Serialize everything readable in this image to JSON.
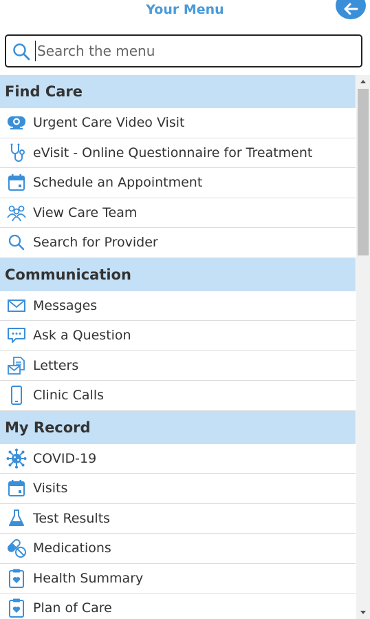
{
  "header": {
    "title": "Your Menu"
  },
  "search": {
    "placeholder": "Search the menu",
    "value": ""
  },
  "sections": [
    {
      "title": "Find Care",
      "items": [
        {
          "label": "Urgent Care Video Visit",
          "icon": "video-camera-icon"
        },
        {
          "label": "eVisit - Online Questionnaire for Treatment",
          "icon": "stethoscope-icon"
        },
        {
          "label": "Schedule an Appointment",
          "icon": "calendar-icon"
        },
        {
          "label": "View Care Team",
          "icon": "care-team-icon"
        },
        {
          "label": "Search for Provider",
          "icon": "search-icon"
        }
      ]
    },
    {
      "title": "Communication",
      "items": [
        {
          "label": "Messages",
          "icon": "envelope-icon"
        },
        {
          "label": "Ask a Question",
          "icon": "chat-bubble-icon"
        },
        {
          "label": "Letters",
          "icon": "letter-icon"
        },
        {
          "label": "Clinic Calls",
          "icon": "mobile-phone-icon"
        }
      ]
    },
    {
      "title": "My Record",
      "items": [
        {
          "label": "COVID-19",
          "icon": "virus-icon"
        },
        {
          "label": "Visits",
          "icon": "calendar-icon"
        },
        {
          "label": "Test Results",
          "icon": "flask-icon"
        },
        {
          "label": "Medications",
          "icon": "pills-icon"
        },
        {
          "label": "Health Summary",
          "icon": "health-summary-icon"
        },
        {
          "label": "Plan of Care",
          "icon": "plan-of-care-icon"
        }
      ]
    }
  ],
  "colors": {
    "accent": "#3b8fd9",
    "section_bg": "#c4e0f6",
    "title": "#4a9ad9"
  }
}
